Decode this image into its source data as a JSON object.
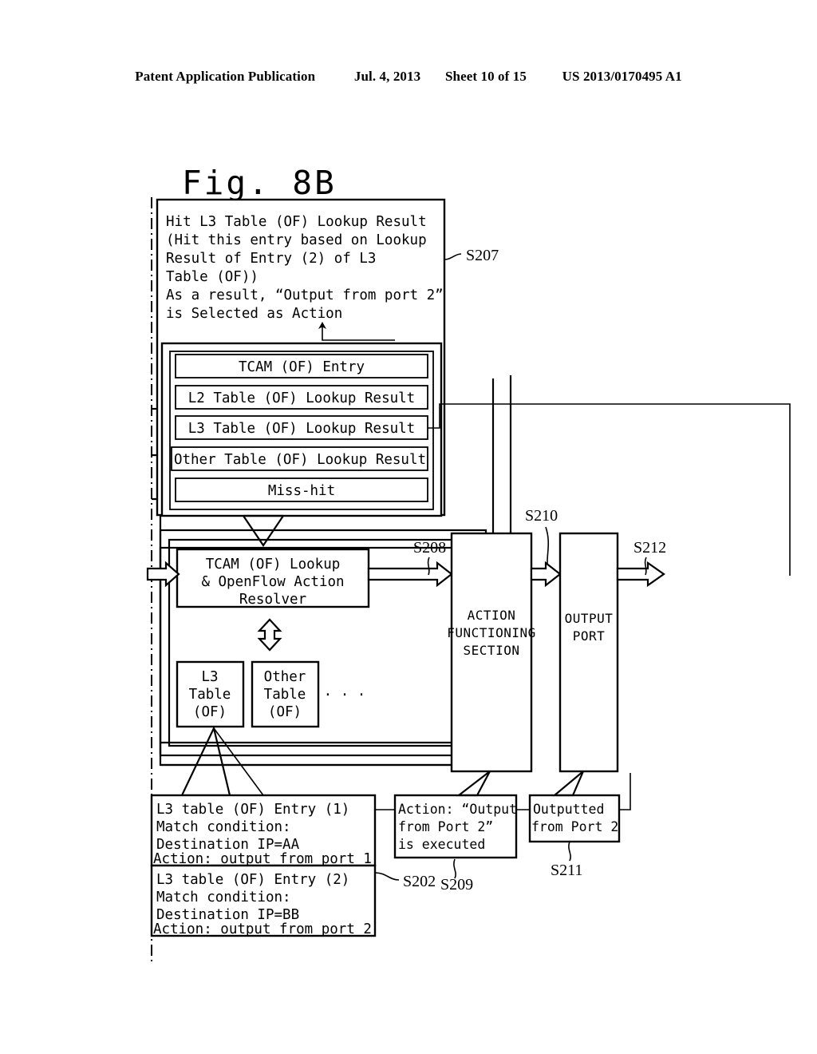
{
  "header": {
    "publication": "Patent Application Publication",
    "date": "Jul. 4, 2013",
    "sheet": "Sheet 10 of 15",
    "patent_number": "US 2013/0170495 A1"
  },
  "figure": {
    "title": "Fig. 8B"
  },
  "result_box": {
    "lines": [
      "Hit L3 Table (OF) Lookup Result",
      " (Hit this entry based on Lookup",
      "Result of Entry (2) of L3",
      "Table (OF))",
      "As a result,  “Output from port 2”",
      "is Selected as Action"
    ],
    "step_label": "S207"
  },
  "lookup_stack": {
    "rows": [
      "TCAM (OF) Entry",
      "L2 Table (OF) Lookup Result",
      "L3 Table (OF) Lookup Result",
      "Other Table (OF) Lookup Result",
      "Miss-hit"
    ]
  },
  "resolver_box": {
    "lines": [
      "TCAM (OF) Lookup",
      "& OpenFlow Action",
      "Resolver"
    ],
    "step_label": "S208"
  },
  "tables": {
    "l3_table": [
      "L3",
      "Table",
      "(OF)"
    ],
    "other_table": [
      "Other",
      "Table",
      "(OF)"
    ],
    "ellipsis": "· · ·"
  },
  "action_section": {
    "lines": [
      "ACTION",
      "FUNCTIONING",
      "SECTION"
    ],
    "step_label": "S210"
  },
  "output_port": {
    "lines": [
      "OUTPUT",
      "PORT"
    ],
    "step_label": "S212"
  },
  "entry_1": {
    "lines": [
      "L3 table (OF) Entry (1)",
      "   Match condition:",
      "   Destination IP=AA",
      "Action: output from port 1"
    ]
  },
  "entry_2": {
    "lines": [
      "L3 table (OF) Entry (2)",
      "   Match condition:",
      "   Destination IP=BB",
      "Action: output from port 2"
    ],
    "step_label": "S202"
  },
  "action_executed": {
    "lines": [
      "Action: “Output",
      " from Port 2”",
      "  is executed"
    ],
    "step_label": "S209"
  },
  "outputted": {
    "lines": [
      "Outputted",
      "from Port 2"
    ],
    "step_label": "S211"
  },
  "colors": {
    "ink": "#000000",
    "paper": "#ffffff"
  }
}
